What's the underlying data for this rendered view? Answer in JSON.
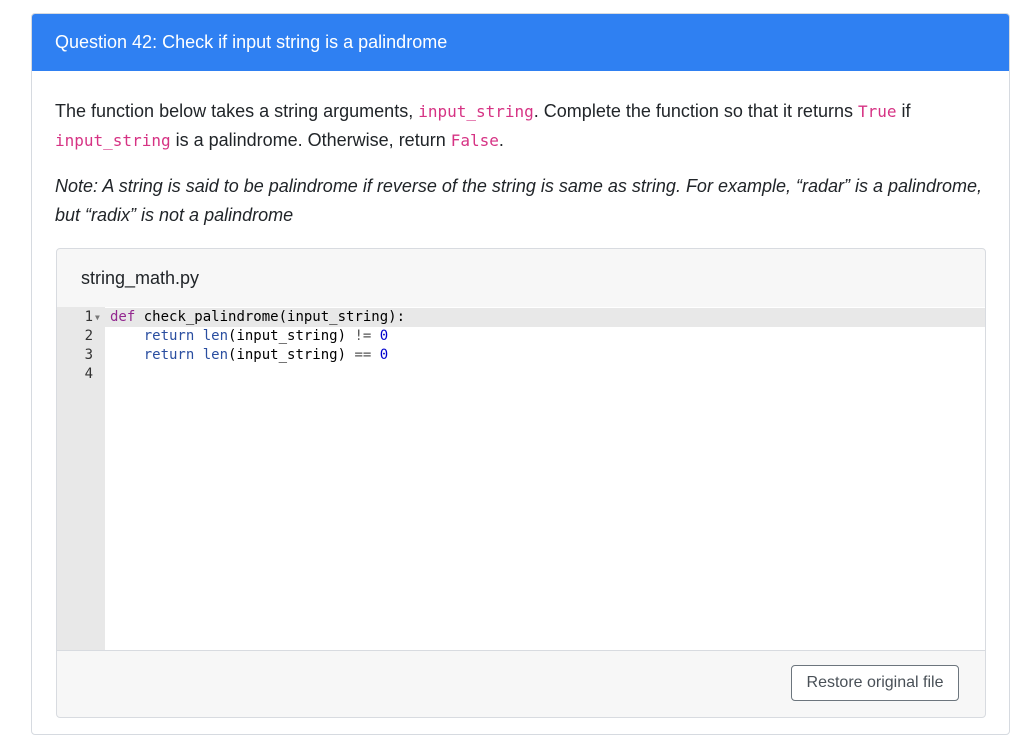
{
  "question": {
    "header": "Question 42: Check if input string is a palindrome",
    "prompt": {
      "t1": "The function below takes a string arguments, ",
      "c1": "input_string",
      "t2": ". Complete the function so that it returns ",
      "c2": "True",
      "t3": " if ",
      "c3": "input_string",
      "t4": " is a palindrome. Otherwise, return ",
      "c4": "False",
      "t5": "."
    },
    "note": "Note: A string is said to be palindrome if reverse of the string is same as string. For example, “radar” is a palindrome, but “radix” is not a palindrome"
  },
  "file": {
    "name": "string_math.py",
    "line_numbers": [
      "1",
      "2",
      "3",
      "4"
    ],
    "code": {
      "l1_kw": "def",
      "l1_rest": " check_palindrome(input_string):",
      "l2_indent": "    ",
      "l2_kw": "return",
      "l2_fn": " len",
      "l2_args": "(input_string) ",
      "l2_op": "!=",
      "l2_num": " 0",
      "l3_indent": "    ",
      "l3_kw": "return",
      "l3_fn": " len",
      "l3_args": "(input_string) ",
      "l3_op": "==",
      "l3_num": " 0"
    },
    "restore_button": "Restore original file"
  },
  "colors": {
    "header_bg": "#2f80f2",
    "inline_code": "#d63384",
    "keyword": "#93278f"
  }
}
